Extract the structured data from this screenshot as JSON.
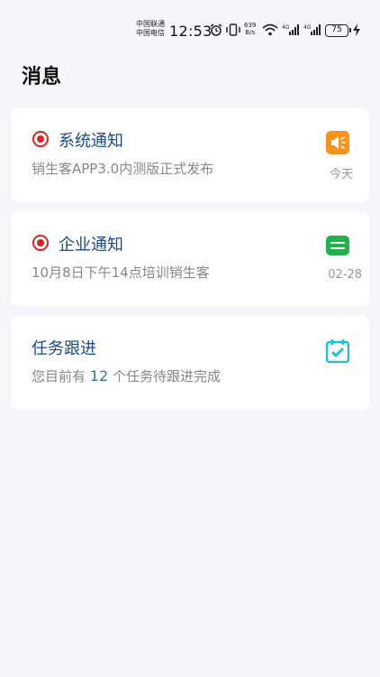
{
  "status_bar": {
    "carrier1": "中国联通",
    "carrier2": "中国电信",
    "time": "12:53",
    "speed_value": "639",
    "speed_unit": "B/s",
    "battery": "75",
    "icons": [
      "alarm-icon",
      "vibrate-icon",
      "wifi-icon",
      "signal-4g-icon",
      "signal-4g-icon",
      "battery-icon",
      "charging-icon"
    ]
  },
  "page": {
    "title": "消息"
  },
  "cards": {
    "system": {
      "title": "系统通知",
      "subtitle": "销生客APP3.0内测版正式发布",
      "date": "今天",
      "icon": "megaphone-icon",
      "icon_color": "#f7931e"
    },
    "enterprise": {
      "title": "企业通知",
      "subtitle": "10月8日下午14点培训销生客",
      "date": "02-28",
      "icon": "message-icon",
      "icon_color": "#22b14c"
    },
    "tasks": {
      "title": "任务跟进",
      "sub_prefix": "您目前有",
      "count": "12",
      "sub_suffix": "个任务待跟进完成",
      "icon": "calendar-check-icon",
      "icon_color": "#19c3d6"
    }
  }
}
